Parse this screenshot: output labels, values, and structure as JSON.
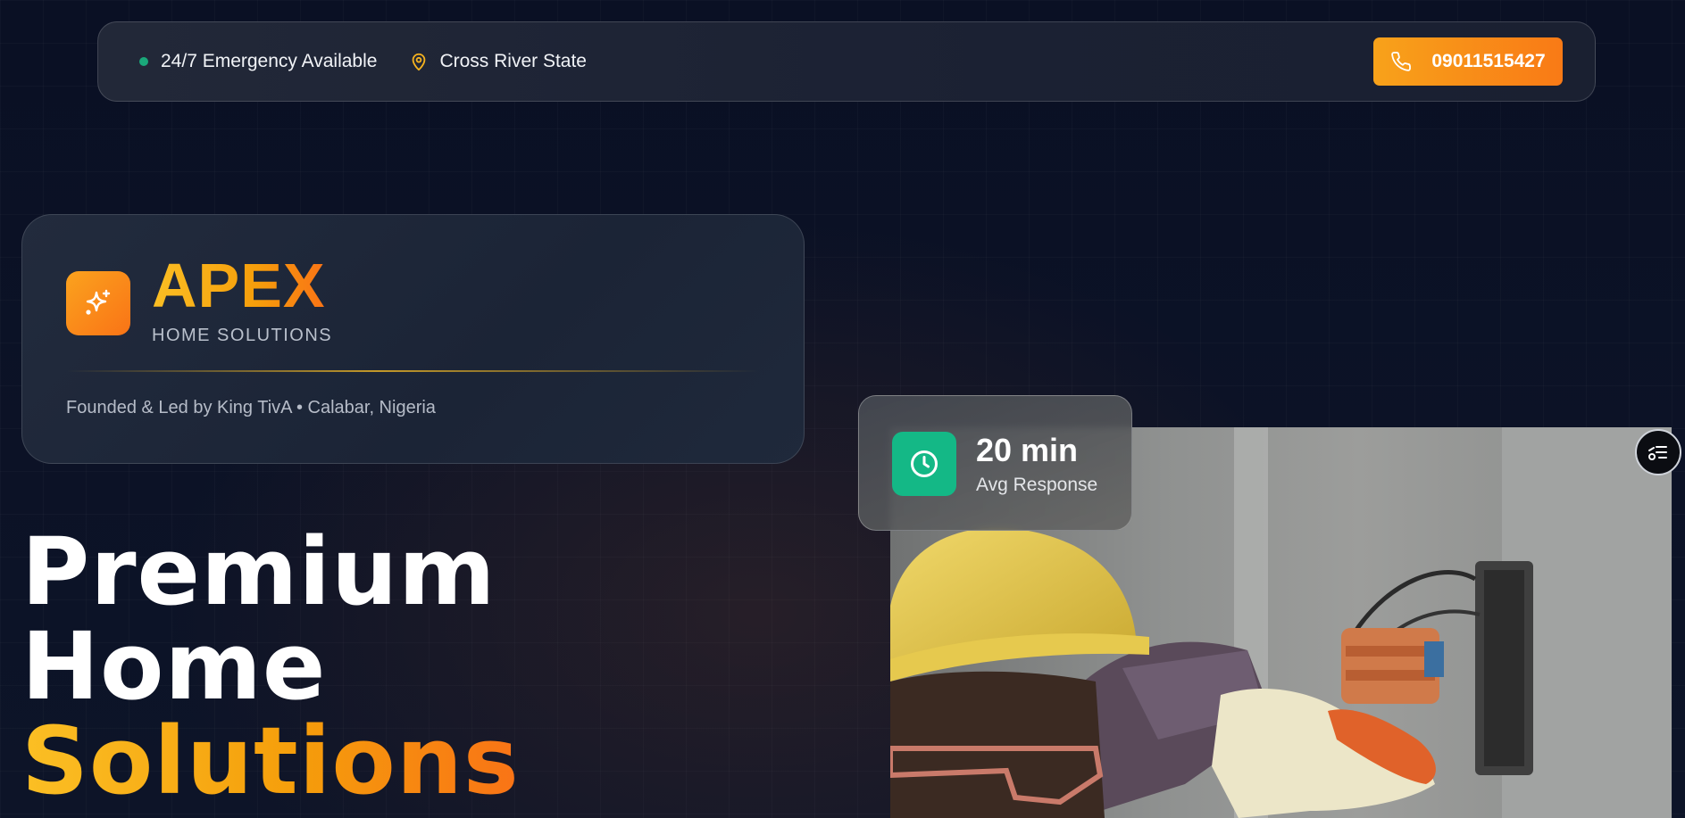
{
  "topbar": {
    "emergency_text": "24/7 Emergency Available",
    "location_text": "Cross River State",
    "phone_number": "09011515427",
    "icons": [
      "status-dot",
      "location-pin-icon",
      "phone-icon"
    ]
  },
  "brand": {
    "name": "APEX",
    "subtitle": "HOME SOLUTIONS",
    "founded_text": "Founded & Led by King TivA • Calabar, Nigeria",
    "logo_icon": "sparkle-icon"
  },
  "hero": {
    "headline_line1": "Premium",
    "headline_line2": "Home",
    "headline_line3": "Solutions"
  },
  "response_badge": {
    "value": "20 min",
    "label": "Avg Response",
    "icon": "clock-icon"
  },
  "floating_button": {
    "icon": "menu-list-icon"
  },
  "colors": {
    "accent_orange": "#f97316",
    "accent_amber": "#fbbf24",
    "status_green": "#1aa87a",
    "badge_green": "#14b886",
    "background": "#0a1024"
  }
}
